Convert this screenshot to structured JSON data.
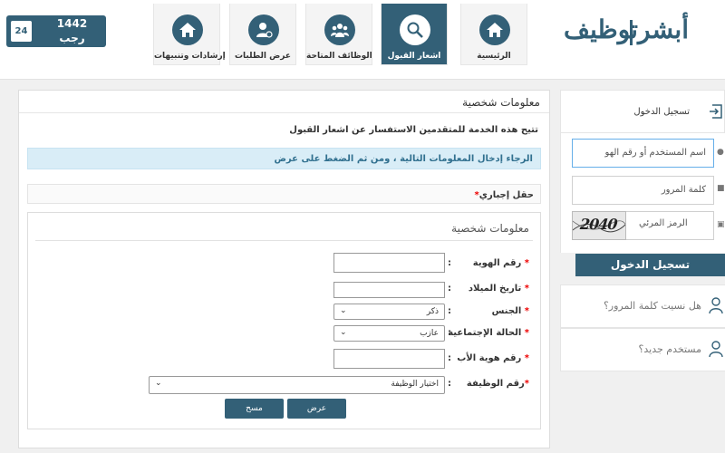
{
  "header": {
    "date": {
      "day": "24",
      "year": "1442",
      "month": "رجب"
    },
    "logo": {
      "brand_left": "أبشر",
      "brand_right": "توظيف"
    },
    "nav": [
      {
        "label": "الرئيسية",
        "icon": "home-icon"
      },
      {
        "label": "اشعار القبول",
        "icon": "magnifier-icon",
        "active": true
      },
      {
        "label": "الوظائف المتاحة",
        "icon": "group-icon"
      },
      {
        "label": "عرض الطلبات",
        "icon": "user-list-icon"
      },
      {
        "label": "إرشادات وتنبيهات",
        "icon": "home-icon"
      }
    ]
  },
  "main": {
    "title": "معلومات شخصية",
    "service_description": "تتيح هذه الخدمة للمتقدمين الاستفسار عن اشعار القبول",
    "info_message": "الرجاء إدخال المعلومات التالية ، ومن ثم الضغط على عرض",
    "required_note": "حقل إجباري",
    "fieldset_title": "معلومات شخصية",
    "fields": {
      "id_number": {
        "label": "رقم الهوية",
        "value": ""
      },
      "birth_date": {
        "label": "تاريخ الميلاد",
        "value": ""
      },
      "gender": {
        "label": "الجنس",
        "selected": "ذكر"
      },
      "marital_status": {
        "label": "الحالة الإجتماعية",
        "selected": "عازب"
      },
      "father_id": {
        "label": "رقم هوية الأب",
        "value": ""
      },
      "job_number": {
        "label": "رقم الوظيفة",
        "selected": "اختيار الوظيفة"
      }
    },
    "buttons": {
      "view": "عرض",
      "clear": "مسح"
    }
  },
  "login": {
    "title": "تسجيل الدخول",
    "username_placeholder": "اسم المستخدم أو رقم الهو",
    "password_placeholder": "كلمة المرور",
    "captcha_label": "الرمز المرئي",
    "captcha_text": "2040",
    "submit": "تسجيل الدخول",
    "forgot_password": "هل نسيت كلمة المرور؟",
    "new_user": "مستخدم جديد؟"
  },
  "colors": {
    "primary": "#336077",
    "info_bg": "#d9edf7",
    "info_text": "#31708f",
    "required": "#e00000"
  }
}
